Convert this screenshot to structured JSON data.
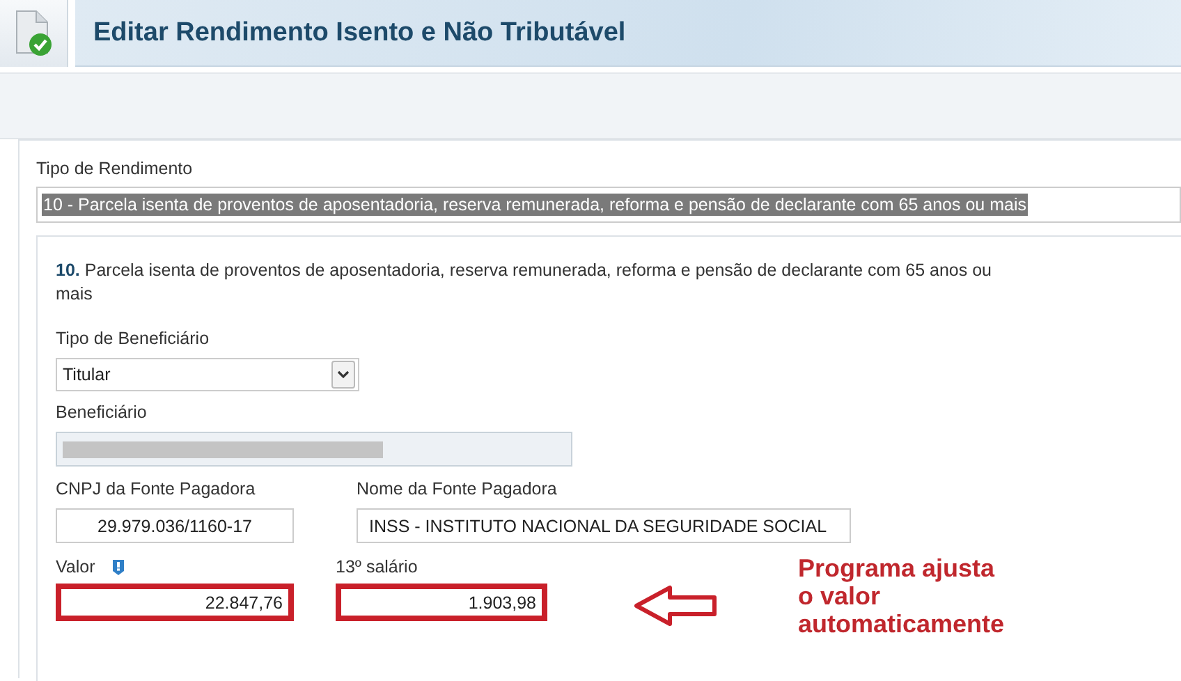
{
  "window": {
    "title": "Editar Rendimento Isento e Não Tributável"
  },
  "income_type": {
    "label": "Tipo de Rendimento",
    "value": "10 - Parcela isenta de proventos de aposentadoria, reserva remunerada, reforma e pensão de declarante com 65 anos ou mais",
    "selected": true
  },
  "description": {
    "number": "10.",
    "text": "Parcela isenta de proventos de aposentadoria, reserva remunerada, reforma e pensão de declarante com 65 anos ou mais"
  },
  "beneficiary_type": {
    "label": "Tipo de Beneficiário",
    "value": "Titular"
  },
  "beneficiary": {
    "label": "Beneficiário",
    "redacted": true
  },
  "payer_cnpj": {
    "label": "CNPJ da Fonte Pagadora",
    "value": "29.979.036/1160-17"
  },
  "payer_name": {
    "label": "Nome da Fonte Pagadora",
    "value": "INSS - INSTITUTO NACIONAL DA SEGURIDADE SOCIAL"
  },
  "amount": {
    "label": "Valor",
    "value": "22.847,76",
    "highlighted": true
  },
  "thirteenth": {
    "label": "13º salário",
    "value": "1.903,98",
    "highlighted": true
  },
  "annotation": {
    "lines": [
      "Programa ajusta",
      "o valor",
      "automaticamente"
    ]
  }
}
